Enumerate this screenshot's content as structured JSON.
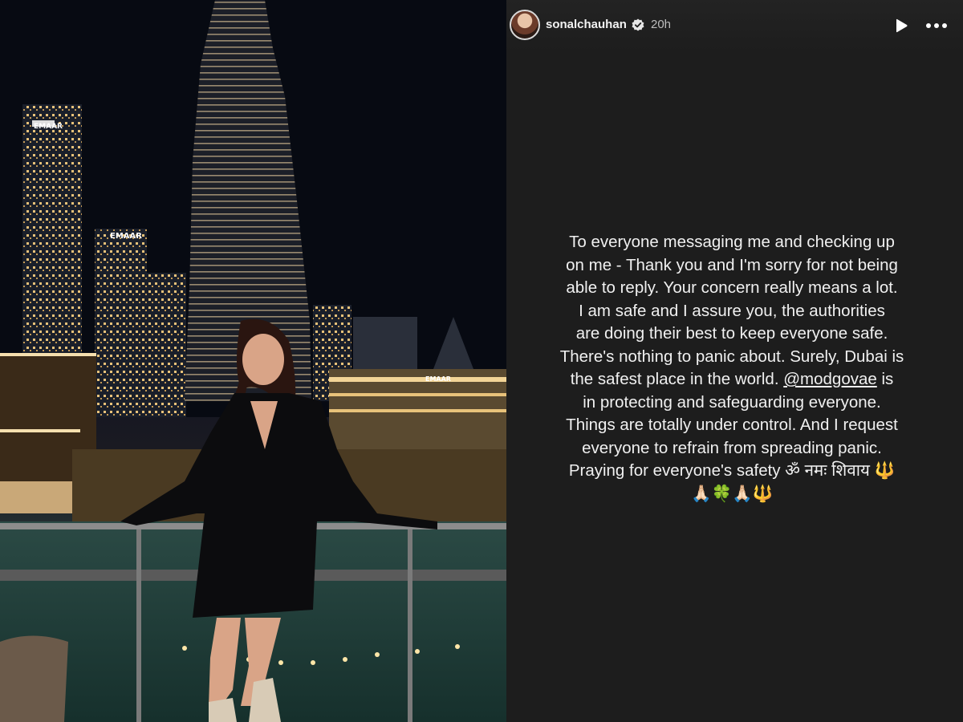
{
  "story": {
    "username": "sonalchauhan",
    "time": "20h",
    "icons": {
      "verified": "verified-badge-icon",
      "play": "play-icon",
      "more": "more-options-icon"
    },
    "message_lines": [
      "To everyone messaging me and checking up",
      "on me - Thank you and I'm sorry for not being",
      "able to reply. Your concern really means a lot.",
      "I am safe and I assure you, the authorities",
      "are doing their best to keep everyone safe.",
      "There's nothing to panic about. Surely, Dubai is",
      "the safest place in the world.",
      "in protecting and safeguarding everyone.",
      "Things are totally under control. And I request",
      "everyone  to refrain from spreading panic."
    ],
    "mention": "@modgovae",
    "mention_suffix": " is",
    "prayer_line_1": "Praying for everyone's safety ॐ नमः शिवाय 🔱",
    "prayer_line_2": "🙏🏻🍀🙏🏻🔱"
  },
  "photo": {
    "sign_1": "EMAAR",
    "sign_2": "EMAAR",
    "sign_3": "EMAAR"
  },
  "colors": {
    "panel_bg": "#1d1d1d",
    "text": "#f0f0f0"
  }
}
